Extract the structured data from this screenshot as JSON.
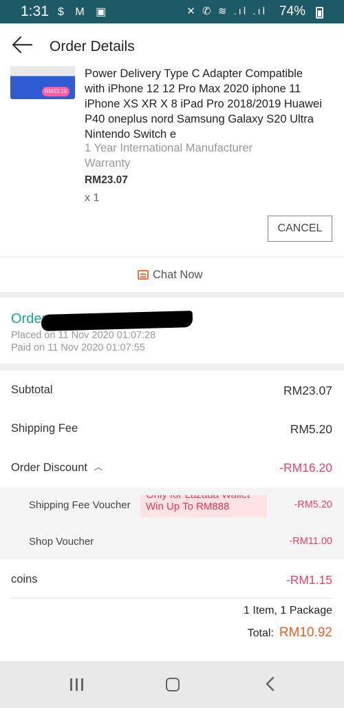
{
  "status_bar": {
    "time": "1:31",
    "left_icons": "$ M ▣",
    "right_icons": "✕ ✆ ≋ .ıl .ıl",
    "battery": "74%"
  },
  "header": {
    "title": "Order Details"
  },
  "product": {
    "thumb_badge": "RM23.19",
    "name": "Power Delivery Type C Adapter Compatible with iPhone 12 12 Pro Max 2020 iphone 11 iPhone XS XR X 8 iPad Pro 2018/2019 Huawei P40 oneplus nord Samsung Galaxy S20 Ultra Nintendo Switch e",
    "warranty": "1 Year International Manufacturer Warranty",
    "price": "RM23.07",
    "quantity": "x 1",
    "cancel_label": "CANCEL"
  },
  "chat": {
    "label": "Chat Now"
  },
  "order": {
    "label": "Order",
    "placed": "Placed on 11 Nov 2020  01:07:28",
    "paid": "Paid on 11 Nov 2020  01:07:55"
  },
  "summary": {
    "subtotal_label": "Subtotal",
    "subtotal_value": "RM23.07",
    "shipping_label": "Shipping Fee",
    "shipping_value": "RM5.20",
    "discount_label": "Order Discount",
    "discount_value": "-RM16.20",
    "shipping_voucher_label": "Shipping Fee Voucher",
    "shipping_voucher_value": "-RM5.20",
    "shop_voucher_label": "Shop Voucher",
    "shop_voucher_value": "-RM11.00",
    "coins_label": "coins",
    "coins_value": "-RM1.15",
    "items_packages": "1 Item, 1 Package",
    "total_label": "Total:",
    "total_value": "RM10.92"
  },
  "tooltip": {
    "line1": "Only for Lazada Wallet",
    "line2": "Win Up To RM888"
  },
  "colors": {
    "status_bar": "#1d5a66",
    "accent_teal": "#1aa39a",
    "discount_red": "#ee3f63",
    "total_orange": "#f15a24"
  }
}
